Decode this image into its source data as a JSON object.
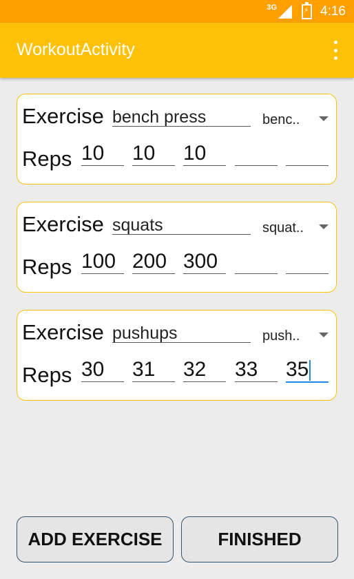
{
  "status_bar": {
    "network": "3G",
    "time": "4:16"
  },
  "app_bar": {
    "title": "WorkoutActivity"
  },
  "labels": {
    "exercise": "Exercise",
    "reps": "Reps"
  },
  "exercises": [
    {
      "name": "bench press",
      "spinner": "benc..",
      "reps": [
        "10",
        "10",
        "10",
        "",
        ""
      ]
    },
    {
      "name": "squats",
      "spinner": "squat..",
      "reps": [
        "100",
        "200",
        "300",
        "",
        ""
      ]
    },
    {
      "name": "pushups",
      "spinner": "push..",
      "reps": [
        "30",
        "31",
        "32",
        "33",
        "35"
      ]
    }
  ],
  "buttons": {
    "add_exercise": "ADD EXERCISE",
    "finished": "FINISHED"
  }
}
